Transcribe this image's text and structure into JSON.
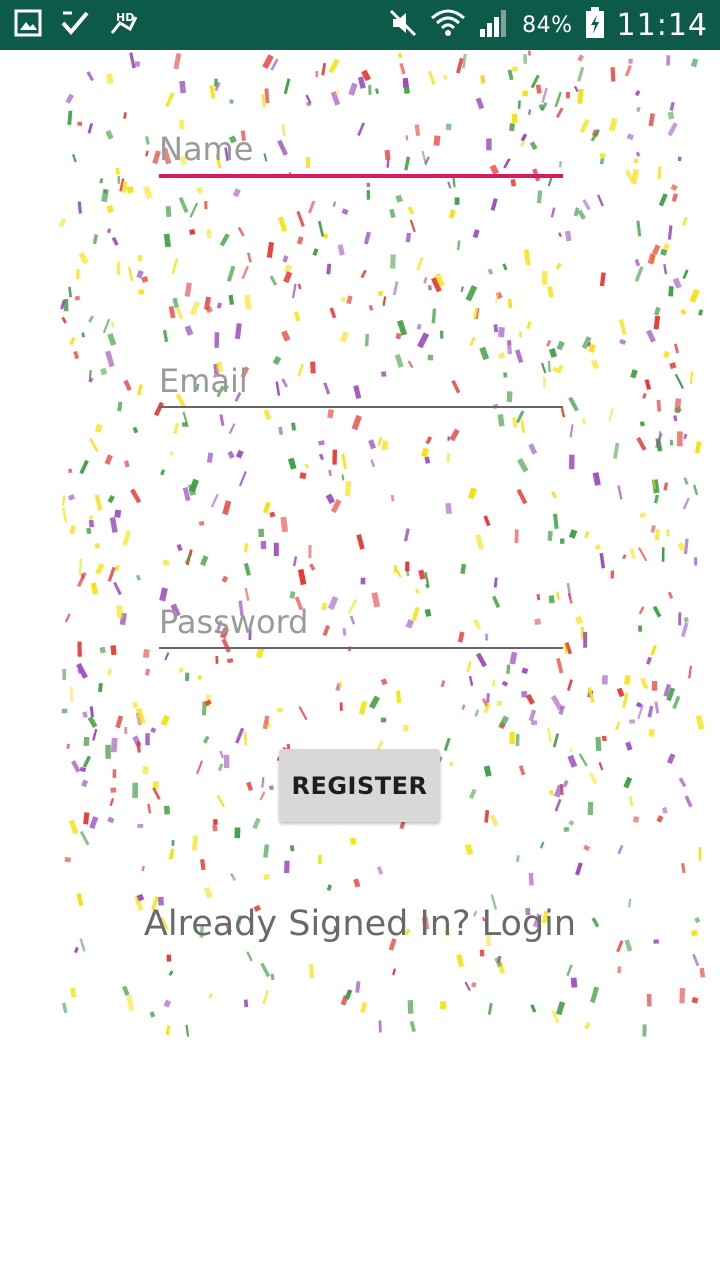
{
  "status_bar": {
    "battery": "84%",
    "time": "11:14",
    "notification_icons": [
      "gallery-icon",
      "task-check-icon",
      "hd-icon"
    ],
    "system_icons": [
      "mute-icon",
      "wifi-icon",
      "signal-icon",
      "battery-icon"
    ]
  },
  "form": {
    "name_placeholder": "Name",
    "email_placeholder": "Email",
    "password_placeholder": "Password",
    "register_label": "REGISTER",
    "login_link": "Already Signed In? Login"
  },
  "colors": {
    "status_bar_bg": "#0d5a4a",
    "focused_underline": "#d81b60",
    "confetti": [
      "#e53935",
      "#f4e20c",
      "#43a047",
      "#9c4dbd"
    ]
  }
}
